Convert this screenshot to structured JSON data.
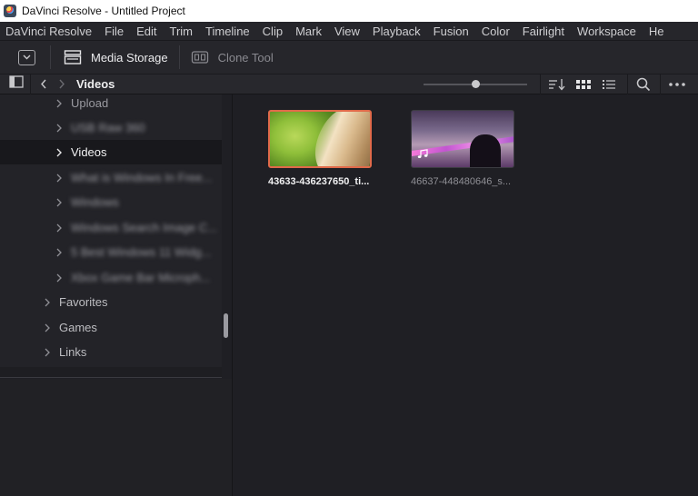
{
  "window": {
    "title": "DaVinci Resolve - Untitled Project"
  },
  "menu": {
    "items": [
      "DaVinci Resolve",
      "File",
      "Edit",
      "Trim",
      "Timeline",
      "Clip",
      "Mark",
      "View",
      "Playback",
      "Fusion",
      "Color",
      "Fairlight",
      "Workspace",
      "He"
    ]
  },
  "toolbar": {
    "media_storage_label": "Media Storage",
    "clone_tool_label": "Clone Tool"
  },
  "path": {
    "current_folder": "Videos"
  },
  "sidebar": {
    "items": [
      {
        "label": "Upload",
        "level": 2,
        "blurred": false,
        "selected": false
      },
      {
        "label": "USB Raw 360",
        "level": 2,
        "blurred": true,
        "selected": false
      },
      {
        "label": "Videos",
        "level": 2,
        "blurred": false,
        "selected": true
      },
      {
        "label": "What is Windows In Free...",
        "level": 2,
        "blurred": true,
        "selected": false
      },
      {
        "label": "Windows",
        "level": 2,
        "blurred": true,
        "selected": false
      },
      {
        "label": "Windows Search Image C...",
        "level": 2,
        "blurred": true,
        "selected": false
      },
      {
        "label": "5 Best Windows 11 Widg...",
        "level": 2,
        "blurred": true,
        "selected": false
      },
      {
        "label": "Xbox Game Bar Microph...",
        "level": 2,
        "blurred": true,
        "selected": false
      },
      {
        "label": "Favorites",
        "level": 1,
        "blurred": false,
        "selected": false
      },
      {
        "label": "Games",
        "level": 1,
        "blurred": false,
        "selected": false
      },
      {
        "label": "Links",
        "level": 1,
        "blurred": false,
        "selected": false
      }
    ]
  },
  "media": {
    "clips": [
      {
        "name": "43633-436237650_ti...",
        "selected": true,
        "has_audio": false
      },
      {
        "name": "46637-448480646_s...",
        "selected": false,
        "has_audio": true
      }
    ]
  },
  "colors": {
    "accent_selection": "#e06a4a",
    "background": "#1f1f24",
    "panel": "#26262b"
  }
}
